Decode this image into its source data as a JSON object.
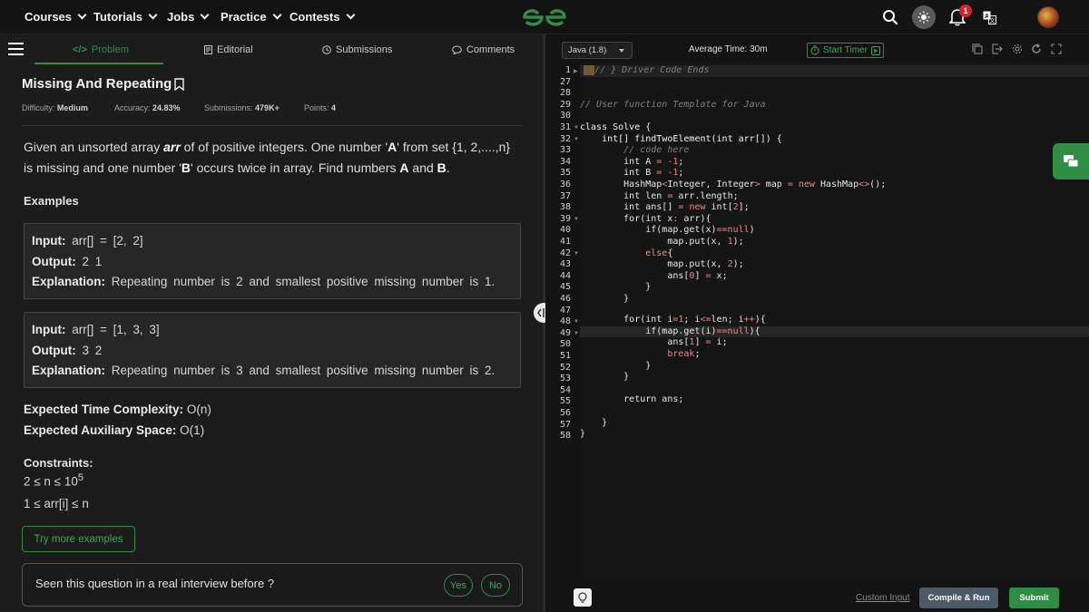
{
  "nav": {
    "items": [
      {
        "label": "Courses"
      },
      {
        "label": "Tutorials"
      },
      {
        "label": "Jobs"
      },
      {
        "label": "Practice"
      },
      {
        "label": "Contests"
      }
    ],
    "notification_count": "1"
  },
  "problem": {
    "tabs": [
      {
        "label": "Problem",
        "icon": "code-icon"
      },
      {
        "label": "Editorial",
        "icon": "document-icon"
      },
      {
        "label": "Submissions",
        "icon": "clock-icon"
      },
      {
        "label": "Comments",
        "icon": "chat-icon"
      }
    ],
    "title": "Missing And Repeating",
    "meta": {
      "difficulty_label": "Difficulty:",
      "difficulty": "Medium",
      "accuracy_label": "Accuracy:",
      "accuracy": "24.83%",
      "submissions_label": "Submissions:",
      "submissions": "479K+",
      "points_label": "Points:",
      "points": "4"
    },
    "description": {
      "p1": "Given an unsorted array ",
      "arr": "arr",
      "p2": " of of positive integers. One number '",
      "a": "A",
      "p3": "' from set {1, 2,....,n} is missing and one number '",
      "b": "B",
      "p4": "' occurs twice in array. Find numbers ",
      "A": "A",
      "p5": " and ",
      "B": "B",
      "p6": "."
    },
    "examples_heading": "Examples",
    "examples": [
      {
        "input_label": "Input:",
        "input": "arr[] = [2, 2]",
        "output_label": "Output:",
        "output": "2 1",
        "explanation_label": "Explanation:",
        "explanation": "Repeating number is 2 and smallest positive missing number is 1."
      },
      {
        "input_label": "Input:",
        "input": "arr[] = [1, 3, 3]",
        "output_label": "Output:",
        "output": "3 2",
        "explanation_label": "Explanation:",
        "explanation": "Repeating number is 3 and smallest positive missing number is 2."
      }
    ],
    "time_complexity_label": "Expected Time Complexity:",
    "time_complexity": "O(n)",
    "aux_space_label": "Expected Auxiliary Space:",
    "aux_space": "O(1)",
    "constraints_heading": "Constraints:",
    "constraint1_base": "2 ≤ n ≤ 10",
    "constraint1_exp": "5",
    "constraint2": "1 ≤ arr[i] ≤ n",
    "try_more": "Try more examples",
    "interview_question": "Seen this question in a real interview before ?",
    "yes": "Yes",
    "no": "No"
  },
  "editor": {
    "language": "Java (1.8)",
    "average_time": "Average Time: 30m",
    "start_timer": "Start Timer",
    "line_numbers": [
      "1",
      "27",
      "28",
      "29",
      "30",
      "31",
      "32",
      "33",
      "34",
      "35",
      "36",
      "37",
      "38",
      "39",
      "40",
      "41",
      "42",
      "43",
      "44",
      "45",
      "46",
      "47",
      "48",
      "49",
      "50",
      "51",
      "52",
      "53",
      "54",
      "55",
      "56",
      "57",
      "58"
    ],
    "custom_input": "Custom Input",
    "compile_run": "Compile & Run",
    "submit": "Submit"
  }
}
